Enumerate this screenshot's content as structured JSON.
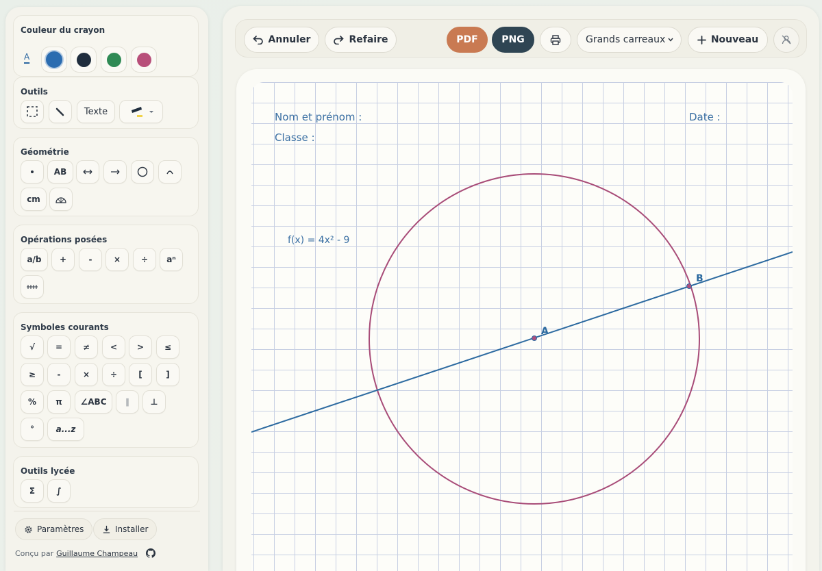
{
  "sidebar": {
    "pen_color": {
      "title": "Couleur du crayon",
      "indicator": "A",
      "swatches": [
        "#2b6cb0",
        "#1f2d3d",
        "#2f8a55",
        "#b84f7a"
      ],
      "selected": "#2b6cb0"
    },
    "tools": {
      "title": "Outils",
      "text_label": "Texte"
    },
    "geometry": {
      "title": "Géométrie",
      "segment_label": "AB",
      "measure_label": "cm"
    },
    "operations": {
      "title": "Opérations posées",
      "fraction_label": "a/b",
      "plus": "+",
      "minus": "-",
      "times": "×",
      "divide": "÷",
      "power_label": "aⁿ"
    },
    "symbols": {
      "title": "Symboles courants",
      "row1": [
        "√",
        "=",
        "≠",
        "<",
        ">",
        "≤"
      ],
      "row2": [
        "≥",
        "-",
        "×",
        "÷",
        "[",
        "]"
      ],
      "row3": [
        "%",
        "π",
        "∠ABC",
        "∥",
        "⊥"
      ],
      "row4": [
        "°",
        "a...z"
      ]
    },
    "lycee": {
      "title": "Outils lycée",
      "sum": "Σ",
      "integral": "∫"
    },
    "footer": {
      "settings_label": "Paramètres",
      "install_label": "Installer",
      "credit_prefix": "Conçu par",
      "credit_author": "Guillaume Champeau"
    }
  },
  "toolbar": {
    "undo_label": "Annuler",
    "redo_label": "Refaire",
    "pdf_label": "PDF",
    "png_label": "PNG",
    "paper_select": "Grands carreaux",
    "new_label": "Nouveau"
  },
  "paper": {
    "name_label": "Nom et prénom :",
    "date_label": "Date :",
    "class_label": "Classe :",
    "function_text": "f(x) = 4x² - 9",
    "point_a": "A",
    "point_b": "B"
  },
  "colors": {
    "accent": "#3a6fa3",
    "circle": "#a84c78",
    "line": "#2c6aa0",
    "grid": "#c7cfe3"
  }
}
